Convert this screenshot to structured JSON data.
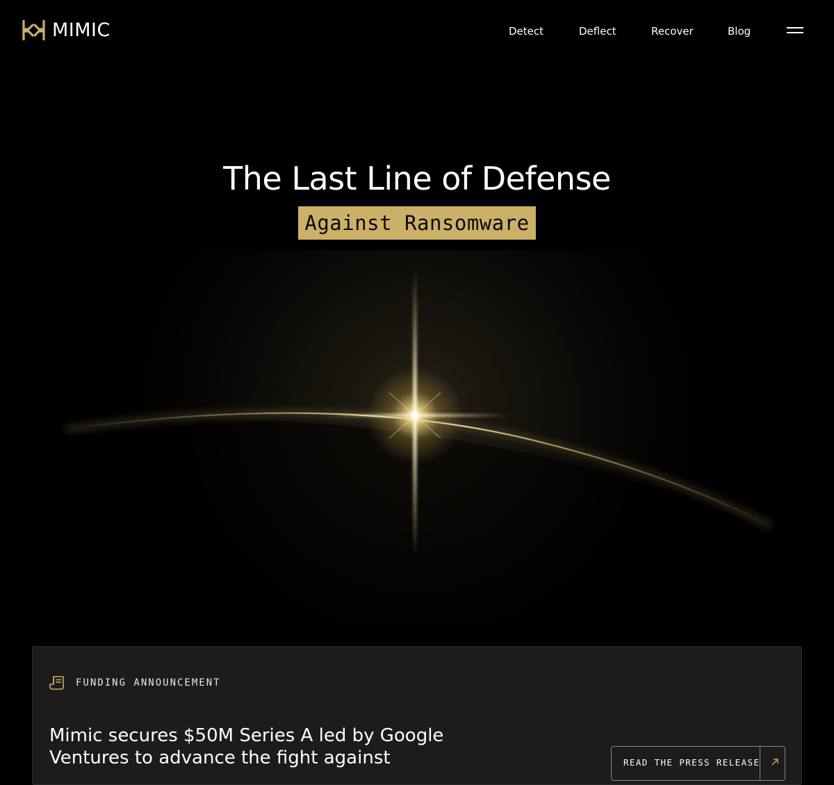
{
  "header": {
    "brand": "MIMIC",
    "nav": [
      {
        "label": "Detect"
      },
      {
        "label": "Deflect"
      },
      {
        "label": "Recover"
      },
      {
        "label": "Blog"
      }
    ],
    "menu_icon": "hamburger-menu-icon"
  },
  "hero": {
    "title": "The Last Line of Defense",
    "subtitle": "Against Ransomware",
    "accent_color": "#cbb067"
  },
  "announcement": {
    "icon": "document-icon",
    "tag": "FUNDING ANNOUNCEMENT",
    "heading": "Mimic secures $50M Series A led by Google Ventures to advance the fight against",
    "button_label": "READ THE PRESS RELEASE",
    "button_icon": "arrow-up-right-icon"
  }
}
